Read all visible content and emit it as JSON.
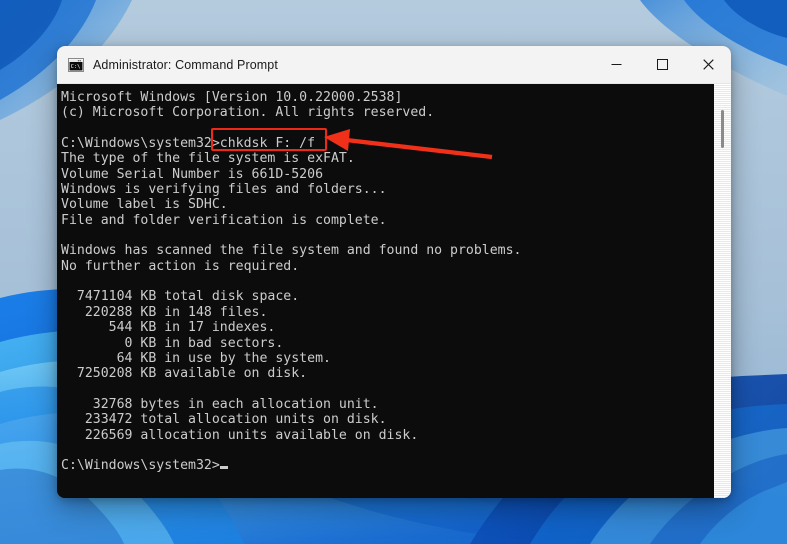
{
  "window": {
    "title": "Administrator: Command Prompt",
    "icon": "command-prompt-icon",
    "controls": {
      "minimize": "—",
      "maximize": "☐",
      "close": "✕"
    }
  },
  "console": {
    "lines": [
      "Microsoft Windows [Version 10.0.22000.2538]",
      "(c) Microsoft Corporation. All rights reserved.",
      "",
      "C:\\Windows\\system32>chkdsk F: /f",
      "The type of the file system is exFAT.",
      "Volume Serial Number is 661D-5206",
      "Windows is verifying files and folders...",
      "Volume label is SDHC.",
      "File and folder verification is complete.",
      "",
      "Windows has scanned the file system and found no problems.",
      "No further action is required.",
      "",
      "  7471104 KB total disk space.",
      "   220288 KB in 148 files.",
      "      544 KB in 17 indexes.",
      "        0 KB in bad sectors.",
      "       64 KB in use by the system.",
      "  7250208 KB available on disk.",
      "",
      "    32768 bytes in each allocation unit.",
      "   233472 total allocation units on disk.",
      "   226569 allocation units available on disk.",
      "",
      "C:\\Windows\\system32>"
    ],
    "prompt": "C:\\Windows\\system32>",
    "command_highlighted": "chkdsk F: /f",
    "cursor": "_",
    "text_color": "#cccccc",
    "background_color": "#0c0c0c"
  },
  "annotations": {
    "highlight_color": "#ee2a16",
    "arrow_color": "#f03019",
    "arrow_label": "points-to-command"
  },
  "desktop": {
    "wallpaper_name": "windows-11-bloom-wallpaper",
    "top_color": "#b2c9dd",
    "bottom_color": "#1569d8"
  }
}
